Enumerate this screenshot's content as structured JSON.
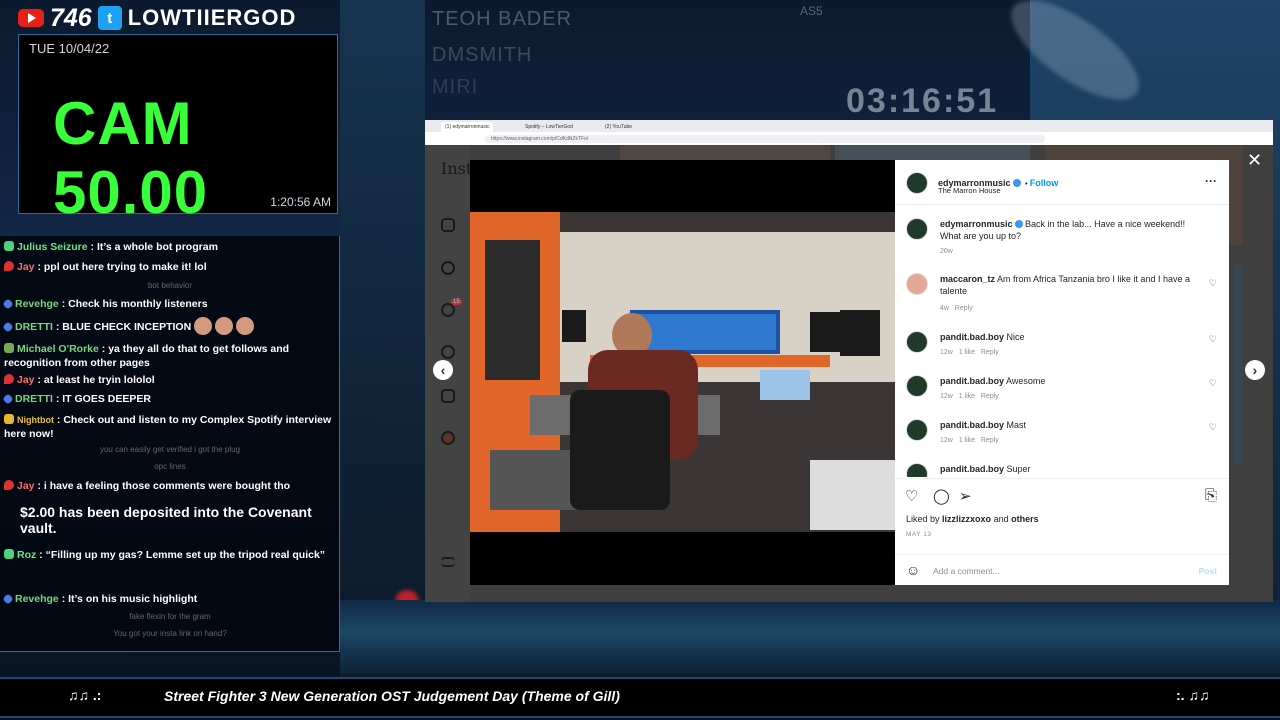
{
  "social": {
    "count": "746",
    "name": "LOWTIIERGOD"
  },
  "cam": {
    "date": "TUE 10/04/22",
    "value": "CAM 50.00",
    "time": "1:20:56 AM"
  },
  "chat": {
    "m1": {
      "user": "Julius Seizure",
      "text": ": It’s a whole bot program"
    },
    "m2": {
      "user": "Jay",
      "text": ": ppl out here trying to make it! lol"
    },
    "s1": "bot behavior",
    "m3": {
      "user": "Revehge",
      "text": ": Check his monthly listeners"
    },
    "m4": {
      "user": "DRETTI",
      "text": ": BLUE CHECK INCEPTION"
    },
    "m5": {
      "user": "Michael O'Rorke",
      "text": ": ya they all do that to get follows and recognition from other pages"
    },
    "m6": {
      "user": "Jay",
      "text": ": at least he tryin lololol"
    },
    "m7": {
      "user": "DRETTI",
      "text": ": IT GOES DEEPER"
    },
    "m8": {
      "user": "Nightbot",
      "text": ": Check out and listen to my Complex Spotify interview here now!"
    },
    "s2": "you can easily get verified i got the plug",
    "s3": "opc lines",
    "m9": {
      "user": "Jay",
      "text": ": i have a feeling those comments were bought tho"
    },
    "donation": "$2.00 has been deposited into the Covenant vault.",
    "m10": {
      "user": "Roz",
      "text": ": “Filling up my gas? Lemme set up the tripod real quick”"
    },
    "m11": {
      "user": "Revehge",
      "text": ": It’s on his music highlight"
    },
    "s4": "fake flexin for the gram",
    "s5": "You got your insta link on hand?"
  },
  "hud": {
    "l1": "TEOH BADER",
    "l2": "DMSMITH",
    "l3": "MIRI",
    "l4": "AS5",
    "clock": "03:16:51"
  },
  "browser": {
    "tab1": "(1) edymarronmusic",
    "tab2": "Spotify – LowTierGod",
    "tab3": "(2) YouTube",
    "url": "https://www.instagram.com/p/CdKdNZkTFo/"
  },
  "ig": {
    "logo": "Insta",
    "notif_count": "15",
    "post": {
      "user": "edymarronmusic",
      "follow": "Follow",
      "location": "The Marron House",
      "caption_user": "edymarronmusic",
      "caption": "Back in the lab... Have a nice weekend!! What are you up to?",
      "caption_age": "20w",
      "liked_prefix": "Liked by",
      "liked_user": "lizzlizzxoxo",
      "liked_and": "and",
      "liked_others": "others",
      "date": "MAY 13",
      "add_comment": "Add a comment...",
      "post_btn": "Post"
    },
    "comments": [
      {
        "user": "maccaron_tz",
        "text": "Am from Africa Tanzania bro I like it and I have a talente",
        "age": "4w",
        "likes": "",
        "reply": "Reply"
      },
      {
        "user": "pandit.bad.boy",
        "text": "Nice",
        "age": "12w",
        "likes": "1 like",
        "reply": "Reply"
      },
      {
        "user": "pandit.bad.boy",
        "text": "Awesome",
        "age": "12w",
        "likes": "1 like",
        "reply": "Reply"
      },
      {
        "user": "pandit.bad.boy",
        "text": "Mast",
        "age": "12w",
        "likes": "1 like",
        "reply": "Reply"
      },
      {
        "user": "pandit.bad.boy",
        "text": "Super",
        "age": "",
        "likes": "",
        "reply": ""
      }
    ]
  },
  "music": {
    "song": "Street Fighter 3 New Generation OST Judgement Day (Theme of Gill)",
    "left": "♫♫ .:",
    ":. ♫♫": "",
    "right": ":. ♫♫"
  },
  "colors": {
    "cam_green": "#39ff3a",
    "ig_blue": "#0095f6",
    "frame_blue": "#2a6fa0"
  }
}
